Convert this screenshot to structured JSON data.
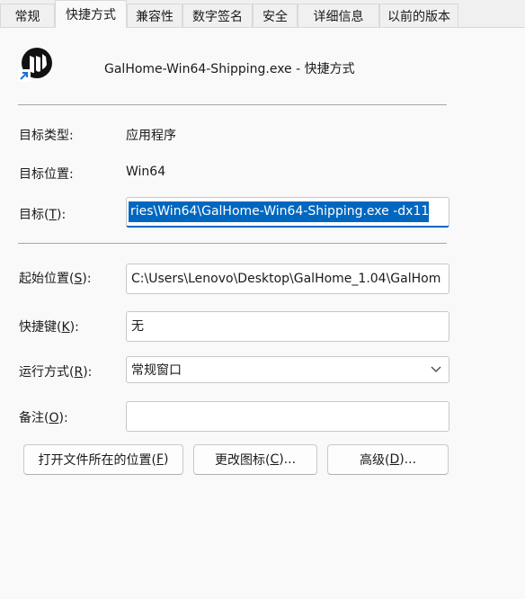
{
  "tabs": [
    {
      "label": "常规"
    },
    {
      "label": "快捷方式"
    },
    {
      "label": "兼容性"
    },
    {
      "label": "数字签名"
    },
    {
      "label": "安全"
    },
    {
      "label": "详细信息"
    },
    {
      "label": "以前的版本"
    }
  ],
  "active_tab": "快捷方式",
  "header": {
    "title": "GalHome-Win64-Shipping.exe - 快捷方式",
    "icon": "unreal-engine-shortcut-icon"
  },
  "fields": {
    "target_type": {
      "label": "目标类型:",
      "value": "应用程序"
    },
    "target_location": {
      "label": "目标位置:",
      "value": "Win64"
    },
    "target": {
      "label_prefix": "目标(",
      "label_key": "T",
      "label_suffix": "):",
      "value": "ries\\Win64\\GalHome-Win64-Shipping.exe -dx11"
    },
    "start_in": {
      "label_prefix": "起始位置(",
      "label_key": "S",
      "label_suffix": "):",
      "value": "C:\\Users\\Lenovo\\Desktop\\GalHome_1.04\\GalHom"
    },
    "hotkey": {
      "label_prefix": "快捷键(",
      "label_key": "K",
      "label_suffix": "):",
      "value": "无"
    },
    "run": {
      "label_prefix": "运行方式(",
      "label_key": "R",
      "label_suffix": "):",
      "value": "常规窗口"
    },
    "comment": {
      "label_prefix": "备注(",
      "label_key": "O",
      "label_suffix": "):",
      "value": ""
    }
  },
  "buttons": {
    "open_location": {
      "prefix": "打开文件所在的位置(",
      "key": "F",
      "suffix": ")"
    },
    "change_icon": {
      "prefix": "更改图标(",
      "key": "C",
      "suffix": ")..."
    },
    "advanced": {
      "prefix": "高级(",
      "key": "D",
      "suffix": ")..."
    }
  },
  "colors": {
    "selection": "#0067c0",
    "background": "#f9f9f9"
  }
}
